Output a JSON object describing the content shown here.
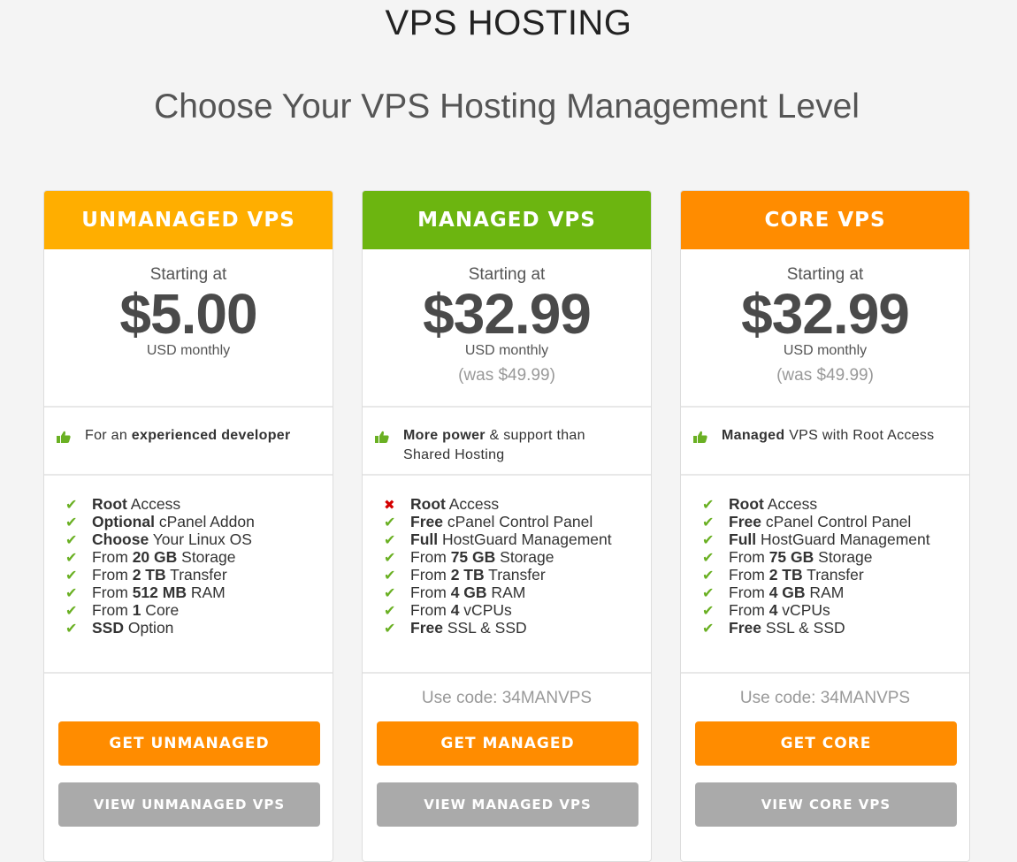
{
  "header": {
    "title": "VPS HOSTING",
    "subtitle": "Choose Your VPS Hosting Management Level"
  },
  "colors": {
    "unmanaged": "#ffae00",
    "managed": "#6cb510",
    "core": "#ff8c00",
    "buy_button": "#ff8c00",
    "view_button": "#aaaaaa",
    "check": "#6ab023",
    "cross": "#d40000"
  },
  "plans": [
    {
      "name": "UNMANAGED VPS",
      "starting": "Starting at",
      "price": "$5.00",
      "period": "USD monthly",
      "was": "",
      "tagline_html": "For an <b>experienced developer</b>",
      "tagline_icon": "thumbs-up-icon",
      "features": [
        {
          "icon": "check",
          "bold": "Root",
          "text": " Access"
        },
        {
          "icon": "check",
          "bold": "Optional",
          "text": " cPanel Addon"
        },
        {
          "icon": "check",
          "bold": "Choose",
          "text": " Your Linux OS"
        },
        {
          "icon": "check",
          "pre": "From ",
          "bold": "20 GB",
          "text": " Storage"
        },
        {
          "icon": "check",
          "pre": "From ",
          "bold": "2 TB",
          "text": " Transfer"
        },
        {
          "icon": "check",
          "pre": "From ",
          "bold": "512 MB",
          "text": " RAM"
        },
        {
          "icon": "check",
          "pre": "From ",
          "bold": "1",
          "text": " Core"
        },
        {
          "icon": "check",
          "bold": "SSD",
          "text": " Option"
        }
      ],
      "code": "",
      "buy_label": "GET UNMANAGED",
      "view_label": "VIEW UNMANAGED VPS"
    },
    {
      "name": "MANAGED VPS",
      "starting": "Starting at",
      "price": "$32.99",
      "period": "USD monthly",
      "was": "(was $49.99)",
      "tagline_html": "<b>More power</b> &amp; support than Shared Hosting",
      "tagline_icon": "thumbs-up-icon",
      "features": [
        {
          "icon": "cross",
          "bold": "Root",
          "text": " Access"
        },
        {
          "icon": "check",
          "bold": "Free",
          "text": " cPanel Control Panel"
        },
        {
          "icon": "check",
          "bold": "Full",
          "text": " HostGuard Management"
        },
        {
          "icon": "check",
          "pre": "From ",
          "bold": "75 GB",
          "text": " Storage"
        },
        {
          "icon": "check",
          "pre": "From ",
          "bold": "2 TB",
          "text": " Transfer"
        },
        {
          "icon": "check",
          "pre": "From ",
          "bold": "4 GB",
          "text": " RAM"
        },
        {
          "icon": "check",
          "pre": "From ",
          "bold": "4",
          "text": " vCPUs"
        },
        {
          "icon": "check",
          "bold": "Free",
          "text": " SSL & SSD"
        }
      ],
      "code": "Use code: 34MANVPS",
      "buy_label": "GET MANAGED",
      "view_label": "VIEW MANAGED VPS"
    },
    {
      "name": "CORE VPS",
      "starting": "Starting at",
      "price": "$32.99",
      "period": "USD monthly",
      "was": "(was $49.99)",
      "tagline_html": "<b>Managed</b> VPS with Root Access",
      "tagline_icon": "thumbs-up-icon",
      "features": [
        {
          "icon": "check",
          "bold": "Root",
          "text": " Access"
        },
        {
          "icon": "check",
          "bold": "Free",
          "text": " cPanel Control Panel"
        },
        {
          "icon": "check",
          "bold": "Full",
          "text": " HostGuard Management"
        },
        {
          "icon": "check",
          "pre": "From ",
          "bold": "75 GB",
          "text": " Storage"
        },
        {
          "icon": "check",
          "pre": "From ",
          "bold": "2 TB",
          "text": " Transfer"
        },
        {
          "icon": "check",
          "pre": "From ",
          "bold": "4 GB",
          "text": " RAM"
        },
        {
          "icon": "check",
          "pre": "From ",
          "bold": "4",
          "text": " vCPUs"
        },
        {
          "icon": "check",
          "bold": "Free",
          "text": " SSL & SSD"
        }
      ],
      "code": "Use code: 34MANVPS",
      "buy_label": "GET CORE",
      "view_label": "VIEW CORE VPS"
    }
  ]
}
